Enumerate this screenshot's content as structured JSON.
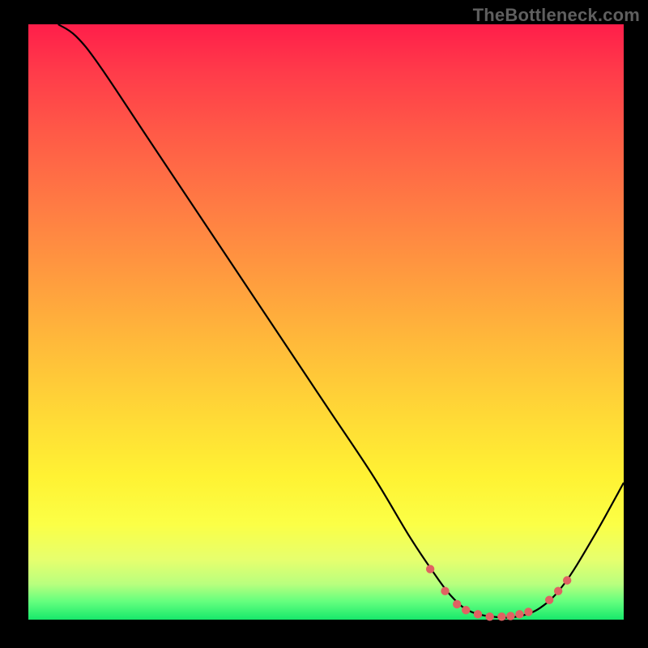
{
  "watermark": "TheBottleneck.com",
  "chart_data": {
    "type": "line",
    "title": "",
    "xlabel": "",
    "ylabel": "",
    "xlim": [
      0,
      100
    ],
    "ylim": [
      0,
      100
    ],
    "curve": [
      {
        "x": 5,
        "y": 100
      },
      {
        "x": 8,
        "y": 98
      },
      {
        "x": 12,
        "y": 93
      },
      {
        "x": 20,
        "y": 81
      },
      {
        "x": 30,
        "y": 66
      },
      {
        "x": 40,
        "y": 51
      },
      {
        "x": 50,
        "y": 36
      },
      {
        "x": 58,
        "y": 24
      },
      {
        "x": 64,
        "y": 14
      },
      {
        "x": 68,
        "y": 8
      },
      {
        "x": 71,
        "y": 4
      },
      {
        "x": 74,
        "y": 1.5
      },
      {
        "x": 78,
        "y": 0.5
      },
      {
        "x": 82,
        "y": 0.5
      },
      {
        "x": 86,
        "y": 2
      },
      {
        "x": 90,
        "y": 6
      },
      {
        "x": 95,
        "y": 14
      },
      {
        "x": 100,
        "y": 23
      }
    ],
    "highlight_points": [
      {
        "x": 67.5,
        "y": 8.5
      },
      {
        "x": 70,
        "y": 4.8
      },
      {
        "x": 72,
        "y": 2.6
      },
      {
        "x": 73.5,
        "y": 1.6
      },
      {
        "x": 75.5,
        "y": 0.9
      },
      {
        "x": 77.5,
        "y": 0.5
      },
      {
        "x": 79.5,
        "y": 0.5
      },
      {
        "x": 81,
        "y": 0.6
      },
      {
        "x": 82.5,
        "y": 0.9
      },
      {
        "x": 84,
        "y": 1.3
      },
      {
        "x": 87.5,
        "y": 3.3
      },
      {
        "x": 89,
        "y": 4.8
      },
      {
        "x": 90.5,
        "y": 6.6
      }
    ],
    "gradient_stops": [
      {
        "pos": 0,
        "color": "#ff1e4a"
      },
      {
        "pos": 8,
        "color": "#ff3b4a"
      },
      {
        "pos": 18,
        "color": "#ff5947"
      },
      {
        "pos": 30,
        "color": "#ff7a44"
      },
      {
        "pos": 42,
        "color": "#ff9a3f"
      },
      {
        "pos": 54,
        "color": "#ffbb3a"
      },
      {
        "pos": 66,
        "color": "#ffda36"
      },
      {
        "pos": 76,
        "color": "#fff233"
      },
      {
        "pos": 84,
        "color": "#fbff46"
      },
      {
        "pos": 90,
        "color": "#e6ff6e"
      },
      {
        "pos": 94,
        "color": "#b9ff7e"
      },
      {
        "pos": 97,
        "color": "#63ff7e"
      },
      {
        "pos": 100,
        "color": "#17e86b"
      }
    ],
    "highlight_color": "#e06262",
    "curve_color": "#000000"
  }
}
